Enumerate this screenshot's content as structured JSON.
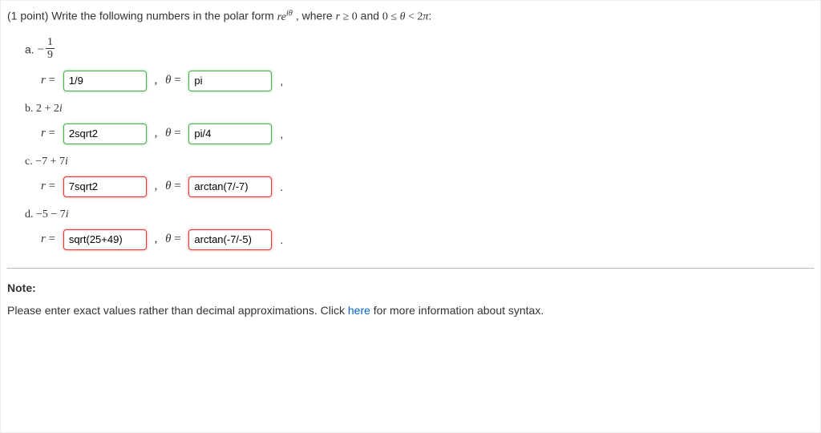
{
  "prompt": {
    "points": "(1 point)",
    "lead": "Write the following numbers in the polar form",
    "polar_form_html": "𝑟𝑒^{𝑖θ}",
    "where": ", where",
    "cond1": "𝑟 ≥ 0",
    "and": "and",
    "cond2": "0 ≤ θ < 2π",
    "colon": ":"
  },
  "labels": {
    "r_eq": "𝑟 = ",
    "theta_eq": "θ = ",
    "sep": " , "
  },
  "parts": {
    "a": {
      "letter": "a.",
      "frac_num": "1",
      "frac_den": "9",
      "r_value": "1/9",
      "r_status": "correct",
      "theta_value": "pi",
      "theta_status": "correct",
      "trail": ","
    },
    "b": {
      "label": "b. 2 + 2𝑖",
      "r_value": "2sqrt2",
      "r_status": "correct",
      "theta_value": "pi/4",
      "theta_status": "correct",
      "trail": ","
    },
    "c": {
      "label": "c. −7 + 7𝑖",
      "r_value": "7sqrt2",
      "r_status": "wrong",
      "theta_value": "arctan(7/-7)",
      "theta_status": "wrong",
      "trail": "."
    },
    "d": {
      "label": "d. −5 − 7𝑖",
      "r_value": "sqrt(25+49)",
      "r_status": "wrong",
      "theta_value": "arctan(-7/-5)",
      "theta_status": "wrong",
      "trail": "."
    }
  },
  "note": {
    "label": "Note:",
    "text_before": "Please enter exact values rather than decimal approximations. Click ",
    "link": "here",
    "text_after": " for more information about syntax."
  }
}
